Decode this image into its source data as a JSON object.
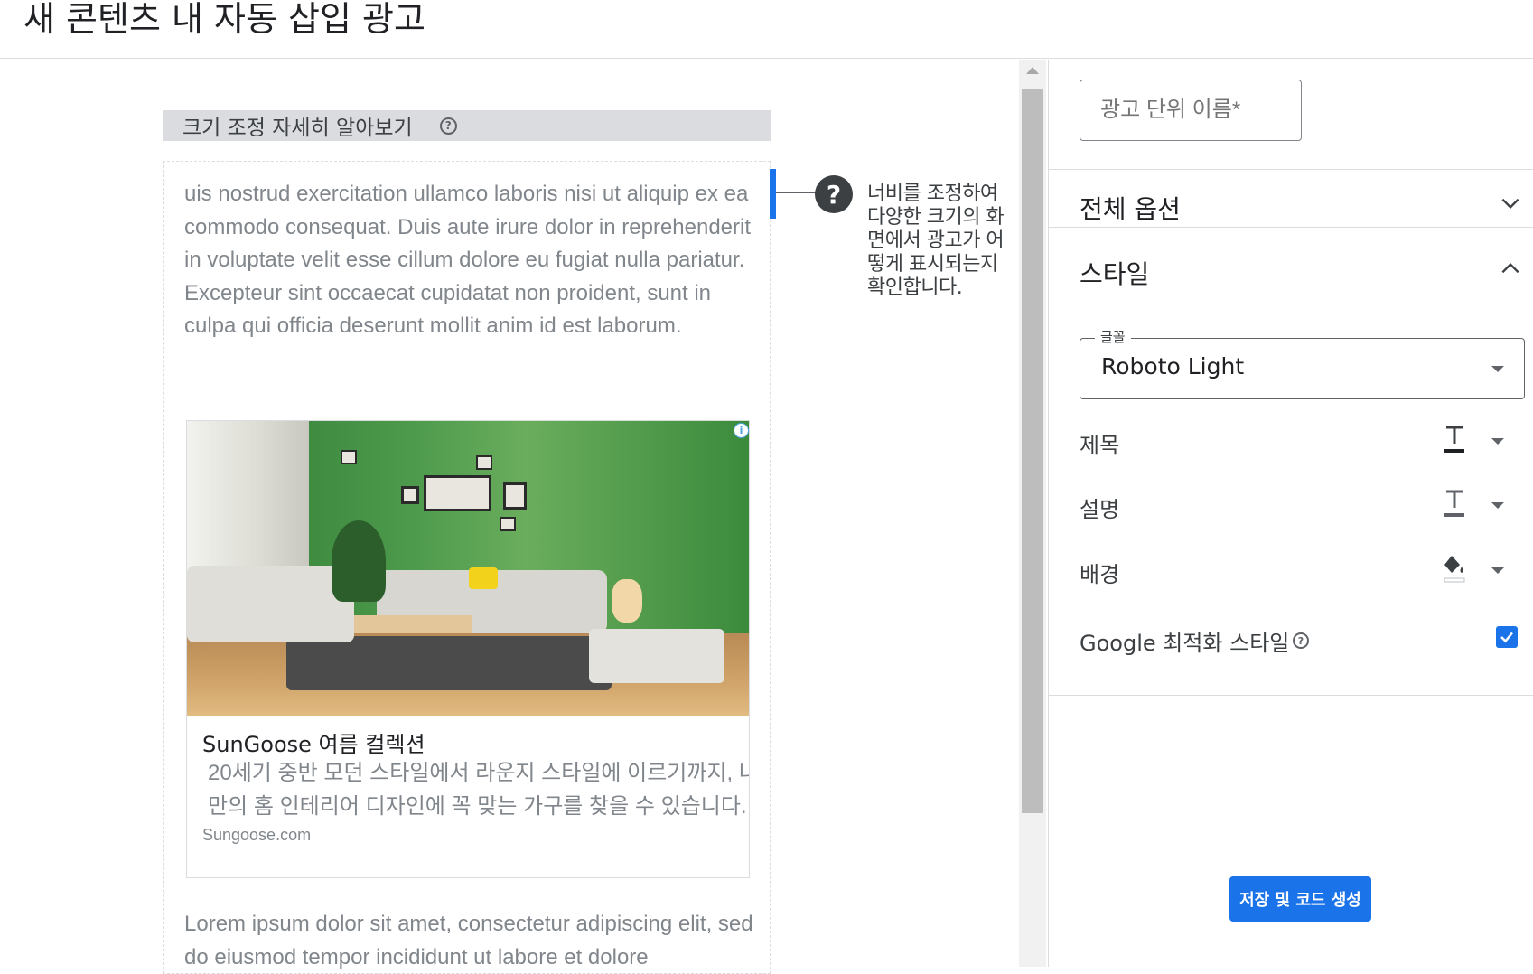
{
  "header": {
    "title": "새 콘텐츠 내 자동 삽입 광고"
  },
  "preview": {
    "resize_label": "크기 조정 자세히 알아보기",
    "paragraph_1": "uis nostrud exercitation ullamco laboris nisi ut aliquip ex ea commodo consequat. Duis aute irure dolor in reprehenderit in voluptate velit esse cillum dolore eu fugiat nulla pariatur. Excepteur sint occaecat cupidatat non proident, sunt in culpa qui officia deserunt mollit anim id est laborum.",
    "paragraph_2": "Lorem ipsum dolor sit amet, consectetur adipiscing elit, sed do eiusmod tempor incididunt ut labore et dolore",
    "ad": {
      "title": "SunGoose 여름 컬렉션",
      "description": "20세기 중반 모던 스타일에서 라운지 스타일에 이르기까지, 나만의 홈 인테리어 디자인에 꼭 맞는 가구를 찾을 수 있습니다.",
      "domain": "Sungoose.com",
      "info_icon": "info-icon"
    },
    "tip_text": "너비를 조정하여 다양한 크기의 화면에서 광고가 어떻게 표시되는지 확인합니다."
  },
  "panel": {
    "ad_unit_name_placeholder": "광고 단위 이름*",
    "sections": {
      "global_options": "전체 옵션",
      "style": "스타일"
    },
    "font_label": "글꼴",
    "font_value": "Roboto Light",
    "rows": {
      "title": "제목",
      "description": "설명",
      "background": "배경"
    },
    "google_optimized_label": "Google 최적화 스타일",
    "google_optimized_checked": true,
    "save_button": "저장 및 코드 생성"
  },
  "colors": {
    "accent": "#1a73e8",
    "resize_bar": "#dadce0"
  }
}
